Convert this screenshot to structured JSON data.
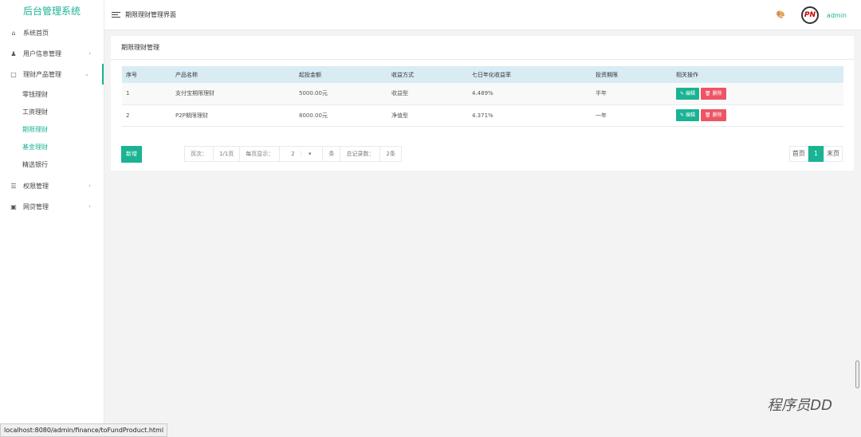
{
  "app": {
    "title": "后台管理系统"
  },
  "sidebar": {
    "items": [
      {
        "label": "系统首页",
        "icon": "home-icon"
      },
      {
        "label": "用户信息管理",
        "icon": "users-icon"
      },
      {
        "label": "理财产品管理",
        "icon": "product-icon"
      }
    ],
    "sub_items": [
      "零钱理财",
      "工资理财",
      "期限理财",
      "基金理财",
      "精选银行"
    ],
    "bottom_items": [
      {
        "label": "权限管理",
        "icon": "permission-icon"
      },
      {
        "label": "网贷管理",
        "icon": "loan-icon"
      }
    ]
  },
  "header": {
    "title": "期限理财管理界面",
    "user": "admin"
  },
  "panel": {
    "title": "期限理财管理"
  },
  "table": {
    "headers": [
      "序号",
      "产品名称",
      "起投金额",
      "收益方式",
      "七日年化收益率",
      "投资期限",
      "相关操作"
    ],
    "rows": [
      [
        "1",
        "支付宝期限理财",
        "5000.00元",
        "收益型",
        "4.489%",
        "半年"
      ],
      [
        "2",
        "P2P期限理财",
        "8000.00元",
        "净值型",
        "4.371%",
        "一年"
      ]
    ],
    "edit_label": "编辑",
    "delete_label": "删除"
  },
  "pager": {
    "new_label": "新增",
    "page_label": "页次：",
    "page_value": "1/1页",
    "per_page_label": "每页显示：",
    "per_page_value": "2",
    "per_page_unit": "条",
    "total_label": "总记录数：",
    "total_value": "2条",
    "first": "首页",
    "current": "1",
    "last": "末页"
  },
  "statusbar": {
    "url": "localhost:8080/admin/finance/toFundProduct.html"
  },
  "watermark": "程序员DD"
}
